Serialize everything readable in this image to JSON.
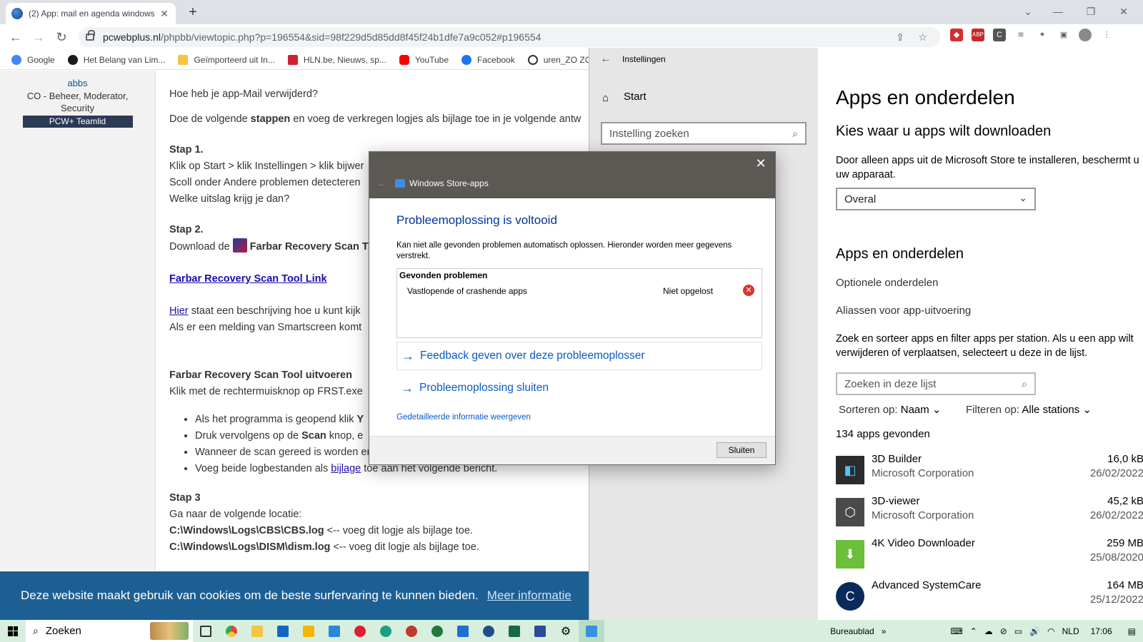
{
  "browser": {
    "tab_title": "(2) App: mail en agenda windows",
    "tab_close": "✕",
    "new_tab": "+",
    "url_host": "pcwebplus.nl",
    "url_path": "/phpbb/viewtopic.php?p=196554&sid=98f229d5d85dd8f45f24b1dfe7a9c052#p196554",
    "bookmarks": [
      {
        "label": "Google",
        "color": "#4285f4"
      },
      {
        "label": "Het Belang van Lim...",
        "color": "#1a1a1a"
      },
      {
        "label": "Geïmporteerd uit In...",
        "color": "#f4c542"
      },
      {
        "label": "HLN.be, Nieuws, sp...",
        "color": "#d3202f"
      },
      {
        "label": "YouTube",
        "color": "#ff0000"
      },
      {
        "label": "Facebook",
        "color": "#1877f2"
      },
      {
        "label": "uren_ZO ZO_",
        "color": "#333333"
      }
    ]
  },
  "forum": {
    "user": "abbs",
    "rank": "CO - Beheer, Moderator, Security",
    "team": "PCW+ Teamlid",
    "lines": {
      "q": "Hoe heb je app-Mail verwijderd?",
      "intro_a": "Doe de volgende ",
      "intro_b": "stappen",
      "intro_c": " en voeg de verkregen logjes als bijlage toe in je volgende antw",
      "stap1": "Stap 1.",
      "s1a": "Klik op Start > klik Instellingen > klik bijwer",
      "s1b": "Scoll onder Andere problemen detecteren",
      "s1c": "Welke uitslag krijg je dan?",
      "stap2": "Stap 2.",
      "s2a": "Download de ",
      "s2b": "Farbar Recovery Scan T",
      "frst_link": "Farbar Recovery Scan Tool Link",
      "hier": "Hier",
      "hier_rest": " staat een beschrijving hoe u kunt kijk",
      "smartscreen": "Als er een melding van Smartscreen komt",
      "frst_run": "Farbar Recovery Scan Tool uitvoeren",
      "frst_exe": "Klik met de rechtermuisknop op FRST.exe",
      "li1a": "Als het programma is geopend klik ",
      "li1b": "Y",
      "li2a": "Druk vervolgens op de ",
      "li2b": "Scan",
      "li2c": " knop, e",
      "li3": "Wanneer de scan gereed is worden er twee logbestanden aangemaakt met de naar",
      "li4a": "Voeg beide logbestanden als ",
      "li4b": "bijlage",
      "li4c": " toe aan het volgende bericht.",
      "stap3": "Stap 3",
      "s3a": "Ga naar de volgende locatie:",
      "s3b_path": "C:\\Windows\\Logs\\CBS\\CBS.log",
      "s3b_rest": " <-- voeg dit logje als bijlage toe.",
      "s3c_path": "C:\\Windows\\Logs\\DISM\\dism.log",
      "s3c_rest": " <-- voeg dit logje als bijlage toe."
    },
    "cookie_text": "Deze website maakt gebruik van cookies om de beste surfervaring te kunnen bieden.",
    "cookie_link": "Meer informatie"
  },
  "settings": {
    "window_title": "Instellingen",
    "home": "Start",
    "search_placeholder": "Instelling zoeken",
    "page_title": "Apps en onderdelen",
    "download_heading": "Kies waar u apps wilt downloaden",
    "download_text_1": "Door alleen apps uit de Microsoft Store te installeren, beschermt u",
    "download_text_2": "uw apparaat.",
    "download_value": "Overal",
    "section_heading": "Apps en onderdelen",
    "optional": "Optionele onderdelen",
    "aliases": "Aliassen voor app-uitvoering",
    "filter_text_1": "Zoek en sorteer apps en filter apps per station. Als u een app wilt",
    "filter_text_2": "verwijderen of verplaatsen, selecteert u deze in de lijst.",
    "list_search_placeholder": "Zoeken in deze lijst",
    "sort_label": "Sorteren op:",
    "sort_value": "Naam",
    "filter_label": "Filteren op:",
    "filter_value": "Alle stations",
    "count": "134 apps gevonden",
    "apps": [
      {
        "name": "3D Builder",
        "publisher": "Microsoft Corporation",
        "size": "16,0 kB",
        "date": "26/02/2022",
        "icon": "3d-builder-icon",
        "glyph": "◧",
        "bg": "#2c2c2c"
      },
      {
        "name": "3D-viewer",
        "publisher": "Microsoft Corporation",
        "size": "45,2 kB",
        "date": "26/02/2022",
        "icon": "3d-viewer-icon",
        "glyph": "⬡",
        "bg": "#4a4a4a"
      },
      {
        "name": "4K Video Downloader",
        "publisher": "",
        "size": "259 MB",
        "date": "25/08/2020",
        "icon": "4k-video-downloader-icon",
        "glyph": "⬇",
        "bg": "#6bbf3a"
      },
      {
        "name": "Advanced SystemCare",
        "publisher": "",
        "size": "164 MB",
        "date": "25/12/2022",
        "icon": "advanced-systemcare-icon",
        "glyph": "C",
        "bg": "#0b2a5c"
      }
    ]
  },
  "dialog": {
    "close": "✕",
    "back": "←",
    "app_title": "Windows Store-apps",
    "title": "Probleemoplossing is voltooid",
    "description": "Kan niet alle gevonden problemen automatisch oplossen. Hieronder worden meer gegevens verstrekt.",
    "problems_heading": "Gevonden problemen",
    "problem_name": "Vastlopende of crashende apps",
    "problem_status": "Niet opgelost",
    "feedback_link": "Feedback geven over deze probleemoplosser",
    "close_link": "Probleemoplossing sluiten",
    "details_link": "Gedetailleerde informatie weergeven",
    "close_button": "Sluiten"
  },
  "taskbar": {
    "search": "Zoeken",
    "desktop": "Bureaublad",
    "lang": "NLD",
    "time": "17:06",
    "apps": [
      {
        "name": "task-view-icon",
        "color": "#333333"
      },
      {
        "name": "chrome-icon",
        "color": "#e8453c"
      },
      {
        "name": "photos-icon",
        "color": "#f4c542"
      },
      {
        "name": "mail-icon",
        "color": "#1565c0"
      },
      {
        "name": "file-explorer-icon",
        "color": "#f2b705"
      },
      {
        "name": "store-icon",
        "color": "#2b88d8"
      },
      {
        "name": "opera-icon",
        "color": "#e01e2f"
      },
      {
        "name": "edge-icon",
        "color": "#1a9f7f"
      },
      {
        "name": "app-red-icon",
        "color": "#c0392b"
      },
      {
        "name": "app-green-icon",
        "color": "#1e7b3a"
      },
      {
        "name": "defender-icon",
        "color": "#1e6fd0"
      },
      {
        "name": "app-blue-icon",
        "color": "#1d4e89"
      },
      {
        "name": "vpn-icon",
        "color": "#17694a"
      },
      {
        "name": "app-tools-icon",
        "color": "#2a4b9b"
      },
      {
        "name": "settings-icon",
        "color": "#444444"
      },
      {
        "name": "troubleshooter-icon",
        "color": "#3a8fe0"
      }
    ]
  }
}
